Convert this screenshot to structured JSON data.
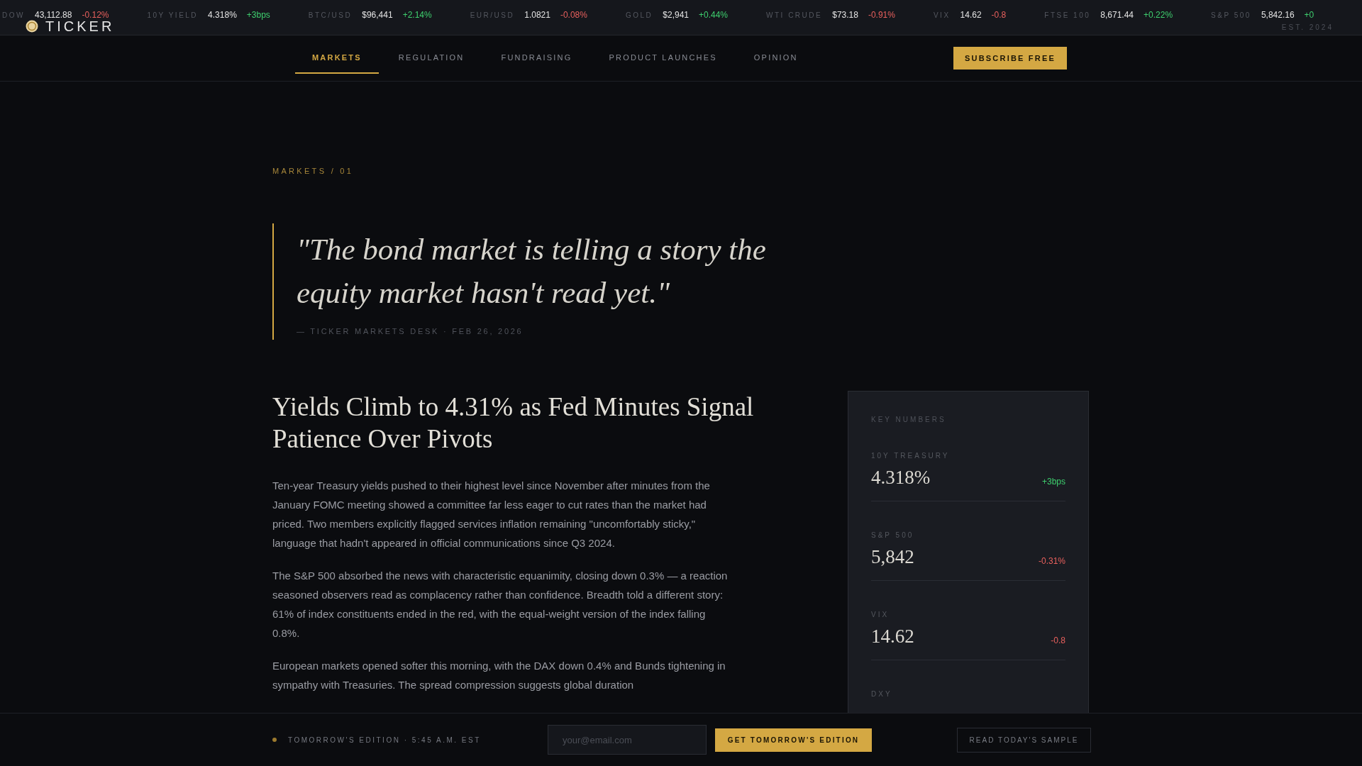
{
  "ticker": [
    {
      "label": "DOW",
      "value": "43,112.88",
      "change": "-0.12%",
      "color": "#e8605d"
    },
    {
      "label": "10Y YIELD",
      "value": "4.318%",
      "change": "+3bps",
      "color": "#3ecf6e"
    },
    {
      "label": "BTC/USD",
      "value": "$96,441",
      "change": "+2.14%",
      "color": "#3ecf6e"
    },
    {
      "label": "EUR/USD",
      "value": "1.0821",
      "change": "-0.08%",
      "color": "#e8605d"
    },
    {
      "label": "GOLD",
      "value": "$2,941",
      "change": "+0.44%",
      "color": "#3ecf6e"
    },
    {
      "label": "WTI CRUDE",
      "value": "$73.18",
      "change": "-0.91%",
      "color": "#e8605d"
    },
    {
      "label": "VIX",
      "value": "14.62",
      "change": "-0.8",
      "color": "#e8605d"
    },
    {
      "label": "FTSE 100",
      "value": "8,671.44",
      "change": "+0.22%",
      "color": "#3ecf6e"
    },
    {
      "label": "S&P 500",
      "value": "5,842.16",
      "change": "+0",
      "color": "#3ecf6e"
    }
  ],
  "logo": {
    "name": "TICKER",
    "tagline": "EST. 2024"
  },
  "nav": {
    "tabs": [
      {
        "label": "MARKETS",
        "selected": true
      },
      {
        "label": "REGULATION",
        "selected": false
      },
      {
        "label": "FUNDRAISING",
        "selected": false
      },
      {
        "label": "PRODUCT LAUNCHES",
        "selected": false
      },
      {
        "label": "OPINION",
        "selected": false
      }
    ],
    "subscribe": "SUBSCRIBE FREE"
  },
  "article": {
    "breadcrumb": "MARKETS / 01",
    "quote": "\"The bond market is telling a story the equity market hasn't read yet.\"",
    "attribution": "— TICKER MARKETS DESK · FEB 26, 2026",
    "headline": "Yields Climb to 4.31% as Fed Minutes Signal Patience Over Pivots",
    "paragraphs": [
      "Ten-year Treasury yields pushed to their highest level since November after minutes from the January FOMC meeting showed a committee far less eager to cut rates than the market had priced. Two members explicitly flagged services inflation remaining \"uncomfortably sticky,\" language that hadn't appeared in official communications since Q3 2024.",
      "The S&P 500 absorbed the news with characteristic equanimity, closing down 0.3% — a reaction seasoned observers read as complacency rather than confidence. Breadth told a different story: 61% of index constituents ended in the red, with the equal-weight version of the index falling 0.8%.",
      "European markets opened softer this morning, with the DAX down 0.4% and Bunds tightening in sympathy with Treasuries. The spread compression suggests global duration"
    ]
  },
  "key_numbers": {
    "title": "KEY NUMBERS",
    "items": [
      {
        "label": "10Y TREASURY",
        "value": "4.318%",
        "change": "+3bps",
        "color": "#3ecf6e"
      },
      {
        "label": "S&P 500",
        "value": "5,842",
        "change": "-0.31%",
        "color": "#e8605d"
      },
      {
        "label": "VIX",
        "value": "14.62",
        "change": "-0.8",
        "color": "#e8605d"
      },
      {
        "label": "DXY"
      }
    ]
  },
  "footer": {
    "status": "TOMORROW'S EDITION · 5:45 A.M. EST",
    "email_placeholder": "your@email.com",
    "cta": "GET TOMORROW'S EDITION",
    "secondary": "READ TODAY'S SAMPLE"
  }
}
